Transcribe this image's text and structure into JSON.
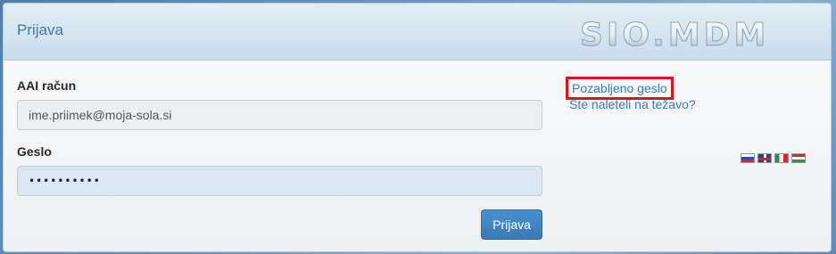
{
  "header": {
    "title": "Prijava",
    "logo_text": "SIO.MDM"
  },
  "form": {
    "account_label": "AAI račun",
    "account_value": "ime.priimek@moja-sola.si",
    "password_label": "Geslo",
    "password_value": "••••••••••",
    "submit_label": "Prijava"
  },
  "links": {
    "forgot_password": "Pozabljeno geslo",
    "trouble": "Ste naleteli na težavo?"
  },
  "languages": [
    {
      "icon": "flag-si-icon",
      "code": "sl"
    },
    {
      "icon": "flag-gb-icon",
      "code": "en"
    },
    {
      "icon": "flag-it-icon",
      "code": "it"
    },
    {
      "icon": "flag-hu-icon",
      "code": "hu"
    }
  ],
  "colors": {
    "accent": "#3a7bbf",
    "highlight_border": "#e0141e",
    "button": "#3a7ab9"
  }
}
